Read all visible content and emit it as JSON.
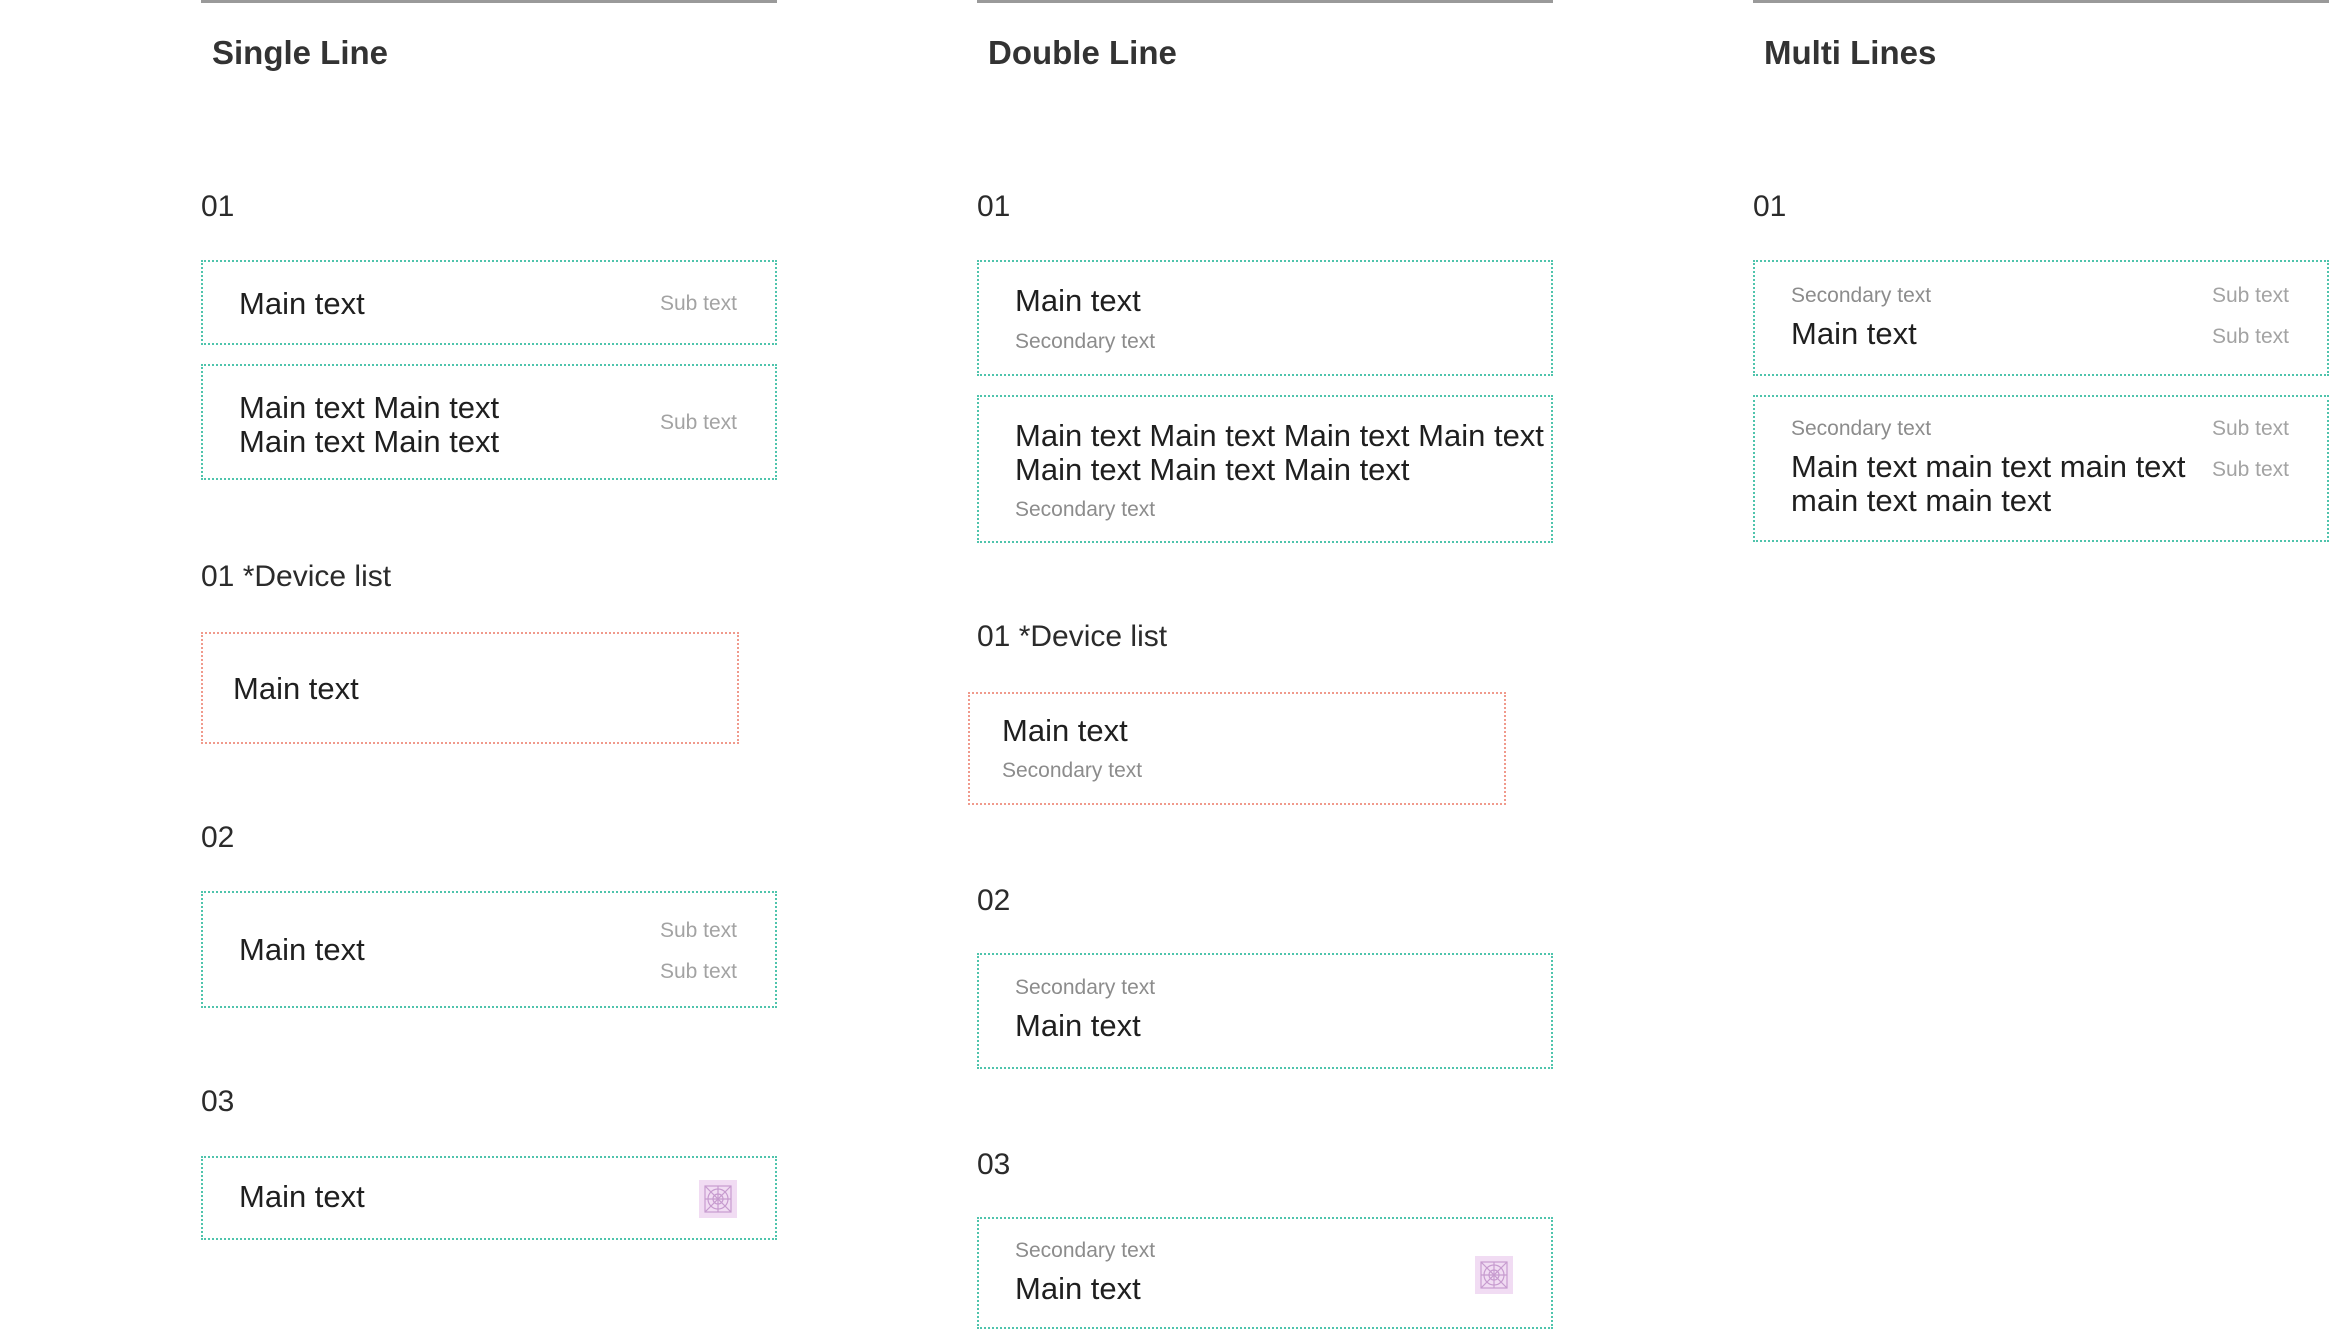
{
  "columns": {
    "single": {
      "title": "Single Line",
      "sec01": "01",
      "item1": {
        "main": "Main text",
        "sub": "Sub text"
      },
      "item2": {
        "main_line1": "Main text Main text",
        "main_line2": "Main text Main text",
        "sub": "Sub text"
      },
      "device_label": "01 *Device list",
      "device_item": {
        "main": "Main text"
      },
      "sec02": "02",
      "item3": {
        "main": "Main text",
        "sub1": "Sub text",
        "sub2": "Sub text"
      },
      "sec03": "03",
      "item4": {
        "main": "Main text",
        "icon": "placeholder-icon"
      }
    },
    "double": {
      "title": "Double Line",
      "sec01": "01",
      "item1": {
        "main": "Main text",
        "secondary": "Secondary text"
      },
      "item2": {
        "main_line1": "Main text Main text Main text Main text",
        "main_line2": "Main text Main text Main text",
        "secondary": "Secondary text"
      },
      "device_label": "01 *Device list",
      "device_item": {
        "main": "Main text",
        "secondary": "Secondary text"
      },
      "sec02": "02",
      "item3": {
        "secondary": "Secondary text",
        "main": "Main text"
      },
      "sec03": "03",
      "item4": {
        "secondary": "Secondary text",
        "main": "Main text",
        "icon": "placeholder-icon"
      }
    },
    "multi": {
      "title": "Multi Lines",
      "sec01": "01",
      "item1": {
        "secondary": "Secondary text",
        "main": "Main text",
        "sub1": "Sub text",
        "sub2": "Sub text"
      },
      "item2": {
        "secondary": "Secondary text",
        "main_line1": "Main text main text main text",
        "main_line2": "main text main text",
        "sub1": "Sub text",
        "sub2": "Sub text"
      }
    }
  },
  "colors": {
    "item_border": "#4fc4ac",
    "device_border": "#f09a8c",
    "icon_fill": "#f1dcf3"
  }
}
